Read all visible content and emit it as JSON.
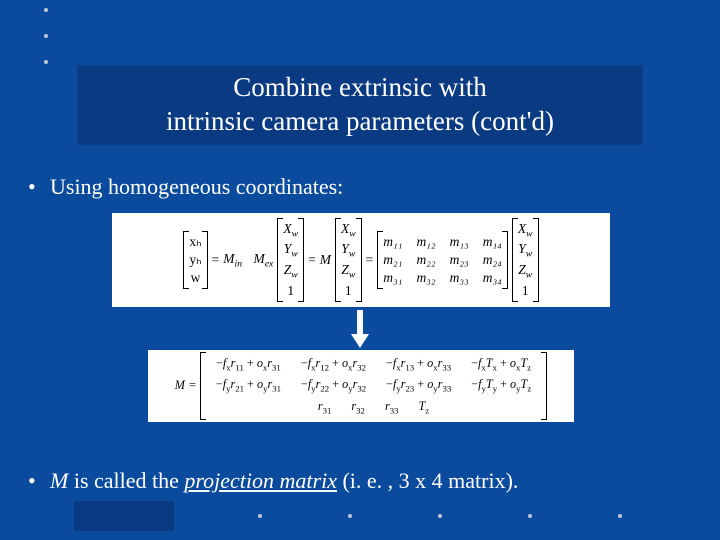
{
  "title": "Combine extrinsic with\nintrinsic camera parameters (cont'd)",
  "bullets": {
    "one": "Using homogeneous coordinates:",
    "two_prefix": " is called the ",
    "two_var": "M",
    "two_pm": "projection matrix",
    "two_suffix": " (i. e. , 3 x 4 matrix)."
  },
  "eq1": {
    "lhs_vec": [
      "xₕ",
      "yₕ",
      "w"
    ],
    "eqA": "=",
    "Min": "M",
    "Min_sub": "in",
    "Mex": "M",
    "Mex_sub": "ex",
    "world_vec": [
      "X_w",
      "Y_w",
      "Z_w",
      "1"
    ],
    "eqB": "=",
    "M": "M",
    "eqC": "=",
    "m_matrix": [
      [
        "m₁₁",
        "m₁₂",
        "m₁₃",
        "m₁₄"
      ],
      [
        "m₂₁",
        "m₂₂",
        "m₂₃",
        "m₂₄"
      ],
      [
        "m₃₁",
        "m₃₂",
        "m₃₃",
        "m₃₄"
      ]
    ]
  },
  "eq2": {
    "lhs": "M",
    "eq": "=",
    "row1": [
      "−fₓr₁₁ + oₓr₃₁",
      "−fₓr₁₂ + oₓr₃₂",
      "−fₓr₁₃ + oₓr₃₃",
      "−fₓTₓ + oₓT_z"
    ],
    "row2": [
      "−f_y r₂₁ + o_y r₃₁",
      "−f_y r₂₂ + o_y r₃₂",
      "−f_y r₂₃ + o_y r₃₃",
      "−f_y T_y + o_y T_z"
    ],
    "row3": [
      "r₃₁",
      "r₃₂",
      "r₃₃",
      "T_z"
    ]
  },
  "chart_data": {
    "type": "table",
    "title": "Projection matrix M = M_in · M_ex (3×4)",
    "symbolic_entries": [
      [
        "-f_x r_11 + o_x r_31",
        "-f_x r_12 + o_x r_32",
        "-f_x r_13 + o_x r_33",
        "-f_x T_x + o_x T_z"
      ],
      [
        "-f_y r_21 + o_y r_31",
        "-f_y r_22 + o_y r_32",
        "-f_y r_23 + o_y r_33",
        "-f_y T_y + o_y T_z"
      ],
      [
        "r_31",
        "r_32",
        "r_33",
        "T_z"
      ]
    ],
    "homogeneous_equation": "[x_h; y_h; w] = M · [X_w; Y_w; Z_w; 1]"
  }
}
